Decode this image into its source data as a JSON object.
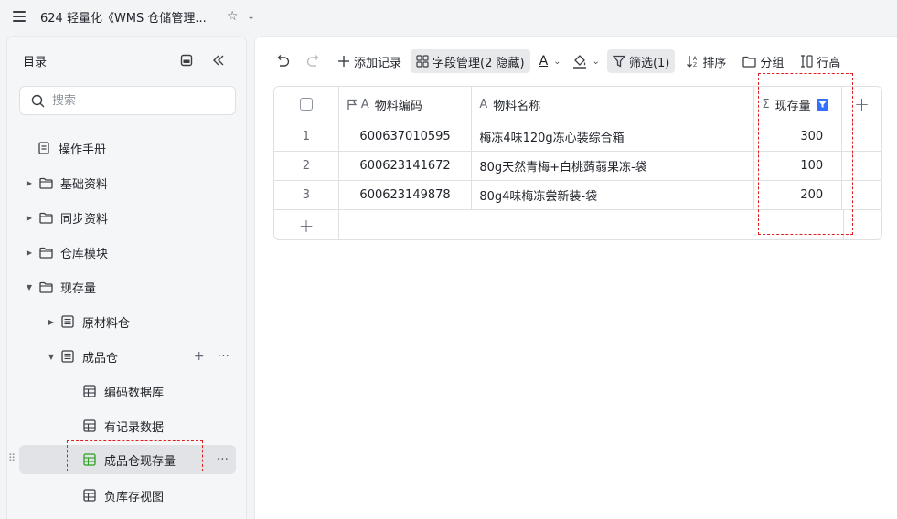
{
  "header": {
    "doc_title": "624 轻量化《WMS 仓储管理...",
    "star_glyph": "☆",
    "caret_glyph": "⌄"
  },
  "sidebar": {
    "title": "目录",
    "search_placeholder": "搜索",
    "items": [
      {
        "label": "操作手册",
        "icon": "doc-icon"
      },
      {
        "label": "基础资料",
        "icon": "folder-icon",
        "arrow": "▶"
      },
      {
        "label": "同步资料",
        "icon": "folder-icon",
        "arrow": "▶"
      },
      {
        "label": "仓库模块",
        "icon": "folder-icon",
        "arrow": "▶"
      },
      {
        "label": "现存量",
        "icon": "folder-icon",
        "arrow": "▼"
      },
      {
        "label": "原材料仓",
        "icon": "list-icon",
        "arrow": "▶"
      },
      {
        "label": "成品仓",
        "icon": "list-icon",
        "arrow": "▼"
      },
      {
        "label": "编码数据库",
        "icon": "table-icon"
      },
      {
        "label": "有记录数据",
        "icon": "table-icon"
      },
      {
        "label": "成品仓现存量",
        "icon": "table-icon",
        "selected": true
      },
      {
        "label": "负库存视图",
        "icon": "table-icon"
      }
    ],
    "row_add_glyph": "+",
    "row_more_glyph": "···",
    "drag_glyph": "⠿"
  },
  "toolbar": {
    "add_record": "添加记录",
    "field_manage": "字段管理(2 隐藏)",
    "text_color_glyph": "A",
    "filter": "筛选(1)",
    "sort": "排序",
    "group": "分组",
    "row_height": "行高"
  },
  "table": {
    "columns": {
      "code": "物料编码",
      "name": "物料名称",
      "qty": "现存量"
    },
    "text_type_glyph": "A",
    "sum_glyph": "Σ",
    "add_glyph": "+",
    "rows": [
      {
        "index": "1",
        "code": "600637010595",
        "name": "梅冻4味120g冻心装综合箱",
        "qty": "300"
      },
      {
        "index": "2",
        "code": "600623141672",
        "name": "80g天然青梅+白桃蒟蒻果冻-袋",
        "qty": "100"
      },
      {
        "index": "3",
        "code": "600623149878",
        "name": "80g4味梅冻尝新装-袋",
        "qty": "200"
      }
    ]
  },
  "colors": {
    "accent": "#3370ff",
    "highlight": "#e02020",
    "selected_bg": "#e1e3e6",
    "table_icon_green": "#2ea121"
  }
}
